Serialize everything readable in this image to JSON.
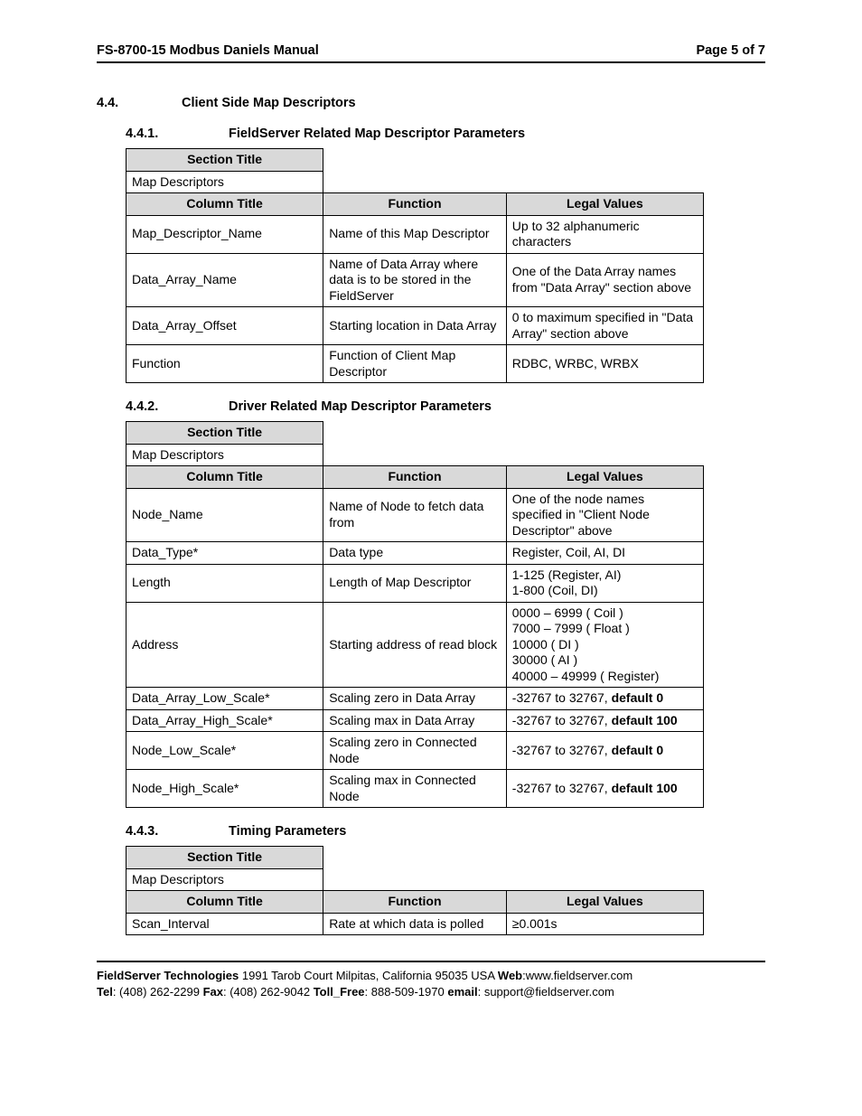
{
  "header": {
    "left": "FS-8700-15 Modbus Daniels Manual",
    "right": "Page 5 of 7"
  },
  "sections": {
    "s44": {
      "num": "4.4.",
      "title": "Client Side Map Descriptors"
    },
    "s441": {
      "num": "4.4.1.",
      "title": "FieldServer Related Map Descriptor Parameters"
    },
    "s442": {
      "num": "4.4.2.",
      "title": "Driver Related Map Descriptor Parameters"
    },
    "s443": {
      "num": "4.4.3.",
      "title": "Timing Parameters"
    }
  },
  "table_common": {
    "section_title_hdr": "Section Title",
    "section_title_val": "Map Descriptors",
    "column_title_hdr": "Column Title",
    "function_hdr": "Function",
    "legal_values_hdr": "Legal Values"
  },
  "t441": {
    "rows": [
      {
        "col": "Map_Descriptor_Name",
        "func": "Name of this Map Descriptor",
        "lv": "Up to 32 alphanumeric characters"
      },
      {
        "col": "Data_Array_Name",
        "func": "Name of Data Array where data is to be stored in the FieldServer",
        "lv": "One of the Data Array names from \"Data Array\" section above"
      },
      {
        "col": "Data_Array_Offset",
        "func": "Starting location in Data Array",
        "lv": "0 to maximum specified in \"Data Array\" section above"
      },
      {
        "col": "Function",
        "func": "Function of Client Map Descriptor",
        "lv": "RDBC, WRBC, WRBX"
      }
    ]
  },
  "t442": {
    "rows": [
      {
        "col": "Node_Name",
        "func": "Name of Node to fetch data from",
        "lv": "One of the node names specified in \"Client Node Descriptor\" above"
      },
      {
        "col": "Data_Type*",
        "func": "Data type",
        "lv": "Register, Coil, AI, DI"
      },
      {
        "col": "Length",
        "func": "Length of Map Descriptor",
        "lv": "",
        "lv_lines": [
          "1-125 (Register, AI)",
          "1-800 (Coil, DI)"
        ]
      },
      {
        "col": "Address",
        "func": "Starting address of read block",
        "lv": "",
        "lv_lines": [
          "0000 – 6999 ( Coil )",
          "7000 – 7999 ( Float )",
          "10000 ( DI )",
          "30000 ( AI )",
          "40000 – 49999 ( Register)"
        ]
      },
      {
        "col": "Data_Array_Low_Scale*",
        "func": "Scaling zero in Data Array",
        "lv_pre": "-32767 to 32767, ",
        "lv_bold": "default 0"
      },
      {
        "col": "Data_Array_High_Scale*",
        "func": "Scaling max in Data Array",
        "lv_pre": "-32767 to 32767, ",
        "lv_bold": "default 100"
      },
      {
        "col": "Node_Low_Scale*",
        "func": "Scaling zero in Connected Node",
        "lv_pre": "-32767 to 32767, ",
        "lv_bold": "default 0"
      },
      {
        "col": "Node_High_Scale*",
        "func": "Scaling max in Connected Node",
        "lv_pre": "-32767 to 32767, ",
        "lv_bold": "default 100"
      }
    ]
  },
  "t443": {
    "rows": [
      {
        "col": "Scan_Interval",
        "func": "Rate at which data is polled",
        "lv": "≥0.001s"
      }
    ]
  },
  "footer": {
    "company_label": "FieldServer Technologies",
    "addr": " 1991 Tarob Court Milpitas, California 95035 USA  ",
    "web_label": "Web",
    "web_val": ":www.fieldserver.com",
    "tel_label": "Tel",
    "tel_val": ": (408) 262-2299  ",
    "fax_label": "Fax",
    "fax_val": ": (408) 262-9042  ",
    "toll_label": "Toll_Free",
    "toll_val": ": 888-509-1970  ",
    "email_label": "email",
    "email_val": ": support@fieldserver.com"
  }
}
